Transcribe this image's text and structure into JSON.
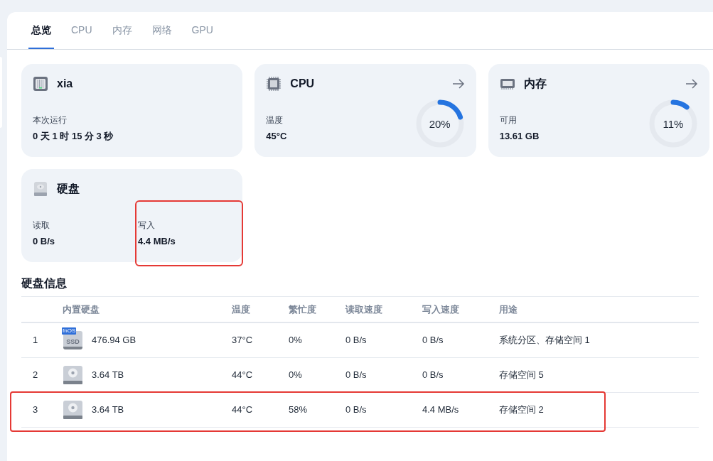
{
  "tabs": [
    {
      "label": "总览",
      "selected": true
    },
    {
      "label": "CPU",
      "selected": false
    },
    {
      "label": "内存",
      "selected": false
    },
    {
      "label": "网络",
      "selected": false
    },
    {
      "label": "GPU",
      "selected": false
    }
  ],
  "cards": [
    {
      "kind": "device",
      "title": "xia",
      "stats": [
        {
          "label": "本次运行",
          "value": "0 天 1 时 15 分 3 秒",
          "highlighted": false
        }
      ]
    },
    {
      "kind": "cpu",
      "title": "CPU",
      "link": true,
      "stats": [
        {
          "label": "温度",
          "value": "45°C",
          "highlighted": false
        }
      ],
      "gauge": {
        "level": 0.2,
        "reading": "20%"
      }
    },
    {
      "kind": "memory",
      "title": "内存",
      "link": true,
      "stats": [
        {
          "label": "可用",
          "value": "13.61 GB",
          "highlighted": false
        }
      ],
      "gauge": {
        "level": 0.11,
        "reading": "11%"
      }
    },
    {
      "kind": "disk",
      "title": "硬盘",
      "stats": [
        {
          "label": "读取",
          "value": "0 B/s",
          "highlighted": false
        },
        {
          "label": "写入",
          "value": "4.4 MB/s",
          "highlighted": true
        }
      ]
    }
  ],
  "disk_table": {
    "title": "硬盘信息",
    "columns": [
      "内置硬盘",
      "温度",
      "繁忙度",
      "读取速度",
      "写入速度",
      "用途"
    ],
    "rows": [
      {
        "index": "1",
        "kind": "ssd",
        "badge": "fnOS",
        "label": "SSD",
        "size": "476.94 GB",
        "temp": "37°C",
        "busy": "0%",
        "read": "0 B/s",
        "write": "0 B/s",
        "use": "系统分区、存储空间 1",
        "highlighted": false
      },
      {
        "index": "2",
        "kind": "hdd",
        "size": "3.64 TB",
        "temp": "44°C",
        "busy": "0%",
        "read": "0 B/s",
        "write": "0 B/s",
        "use": "存储空间 5",
        "highlighted": false
      },
      {
        "index": "3",
        "kind": "hdd",
        "size": "3.64 TB",
        "temp": "44°C",
        "busy": "58%",
        "read": "0 B/s",
        "write": "4.4 MB/s",
        "use": "存储空间 2",
        "highlighted": true
      }
    ]
  }
}
